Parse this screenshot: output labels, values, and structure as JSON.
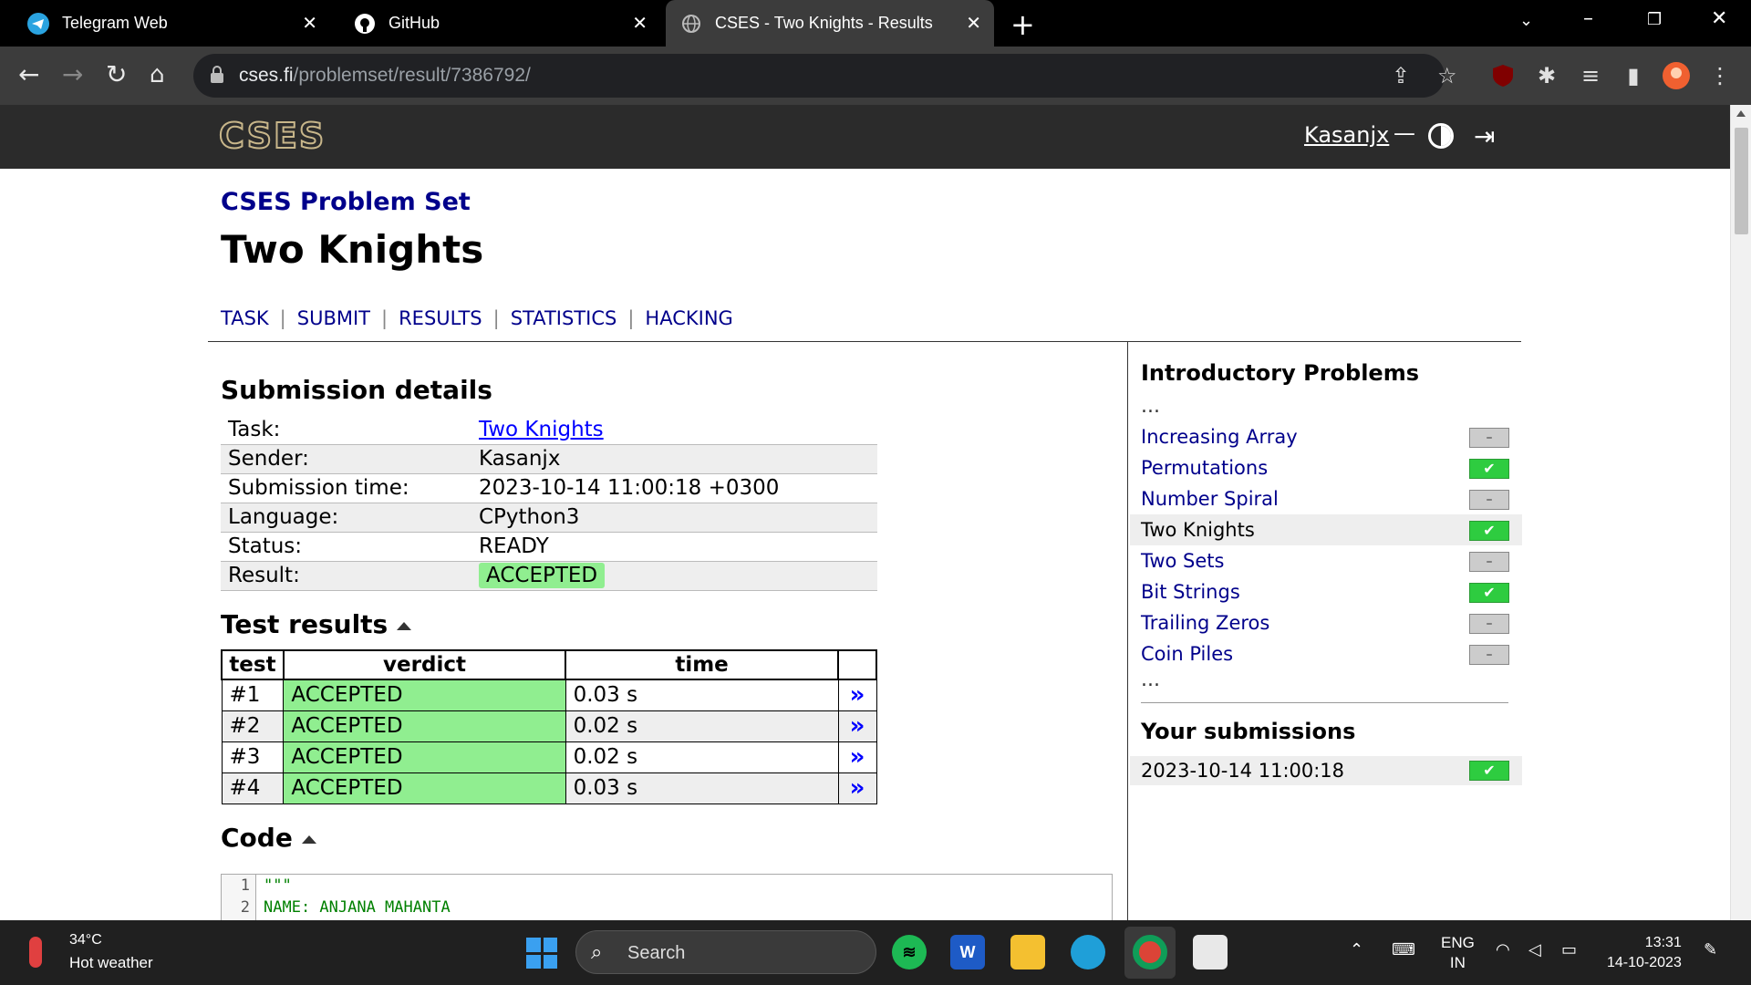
{
  "browser": {
    "tabs": [
      {
        "title": "Telegram Web",
        "icon": "telegram-icon"
      },
      {
        "title": "GitHub",
        "icon": "github-icon"
      },
      {
        "title": "CSES - Two Knights - Results",
        "icon": "globe-icon"
      }
    ],
    "url_host": "cses.fi",
    "url_path": "/problemset/result/7386792/"
  },
  "site": {
    "logo": "CSES",
    "user": "Kasanjx",
    "dash": "—"
  },
  "page": {
    "set_title": "CSES Problem Set",
    "task_title": "Two Knights",
    "nav": [
      "TASK",
      "SUBMIT",
      "RESULTS",
      "STATISTICS",
      "HACKING"
    ],
    "details_heading": "Submission details",
    "details": [
      {
        "label": "Task:",
        "value": "Two Knights",
        "kind": "link"
      },
      {
        "label": "Sender:",
        "value": "Kasanjx",
        "kind": "text"
      },
      {
        "label": "Submission time:",
        "value": "2023-10-14 11:00:18 +0300",
        "kind": "text"
      },
      {
        "label": "Language:",
        "value": "CPython3",
        "kind": "text"
      },
      {
        "label": "Status:",
        "value": "READY",
        "kind": "text"
      },
      {
        "label": "Result:",
        "value": "ACCEPTED",
        "kind": "badge"
      }
    ],
    "tests_heading": "Test results",
    "tests_columns": [
      "test",
      "verdict",
      "time"
    ],
    "tests": [
      {
        "test": "#1",
        "verdict": "ACCEPTED",
        "time": "0.03 s",
        "link": "»"
      },
      {
        "test": "#2",
        "verdict": "ACCEPTED",
        "time": "0.02 s",
        "link": "»"
      },
      {
        "test": "#3",
        "verdict": "ACCEPTED",
        "time": "0.02 s",
        "link": "»"
      },
      {
        "test": "#4",
        "verdict": "ACCEPTED",
        "time": "0.03 s",
        "link": "»"
      }
    ],
    "code_heading": "Code",
    "code_lines": [
      {
        "n": "1",
        "text": "\"\"\""
      },
      {
        "n": "2",
        "text": "NAME: ANJANA MAHANTA"
      }
    ]
  },
  "sidebar": {
    "heading": "Introductory Problems",
    "ellipsis": "...",
    "problems": [
      {
        "name": "Increasing Array",
        "status": "–",
        "solved": false,
        "current": false
      },
      {
        "name": "Permutations",
        "status": "✔",
        "solved": true,
        "current": false
      },
      {
        "name": "Number Spiral",
        "status": "–",
        "solved": false,
        "current": false
      },
      {
        "name": "Two Knights",
        "status": "✔",
        "solved": true,
        "current": true
      },
      {
        "name": "Two Sets",
        "status": "–",
        "solved": false,
        "current": false
      },
      {
        "name": "Bit Strings",
        "status": "✔",
        "solved": true,
        "current": false
      },
      {
        "name": "Trailing Zeros",
        "status": "–",
        "solved": false,
        "current": false
      },
      {
        "name": "Coin Piles",
        "status": "–",
        "solved": false,
        "current": false
      }
    ],
    "submissions_heading": "Your submissions",
    "submission": {
      "time": "2023-10-14 11:00:18",
      "status": "✔"
    }
  },
  "taskbar": {
    "weather_temp": "34°C",
    "weather_desc": "Hot weather",
    "search_placeholder": "Search",
    "lang_1": "ENG",
    "lang_2": "IN",
    "time": "13:31",
    "date": "14-10-2023"
  },
  "colors": {
    "accepted": "#90ee90",
    "link": "#00008b",
    "header_bg": "#2b2b2b"
  }
}
